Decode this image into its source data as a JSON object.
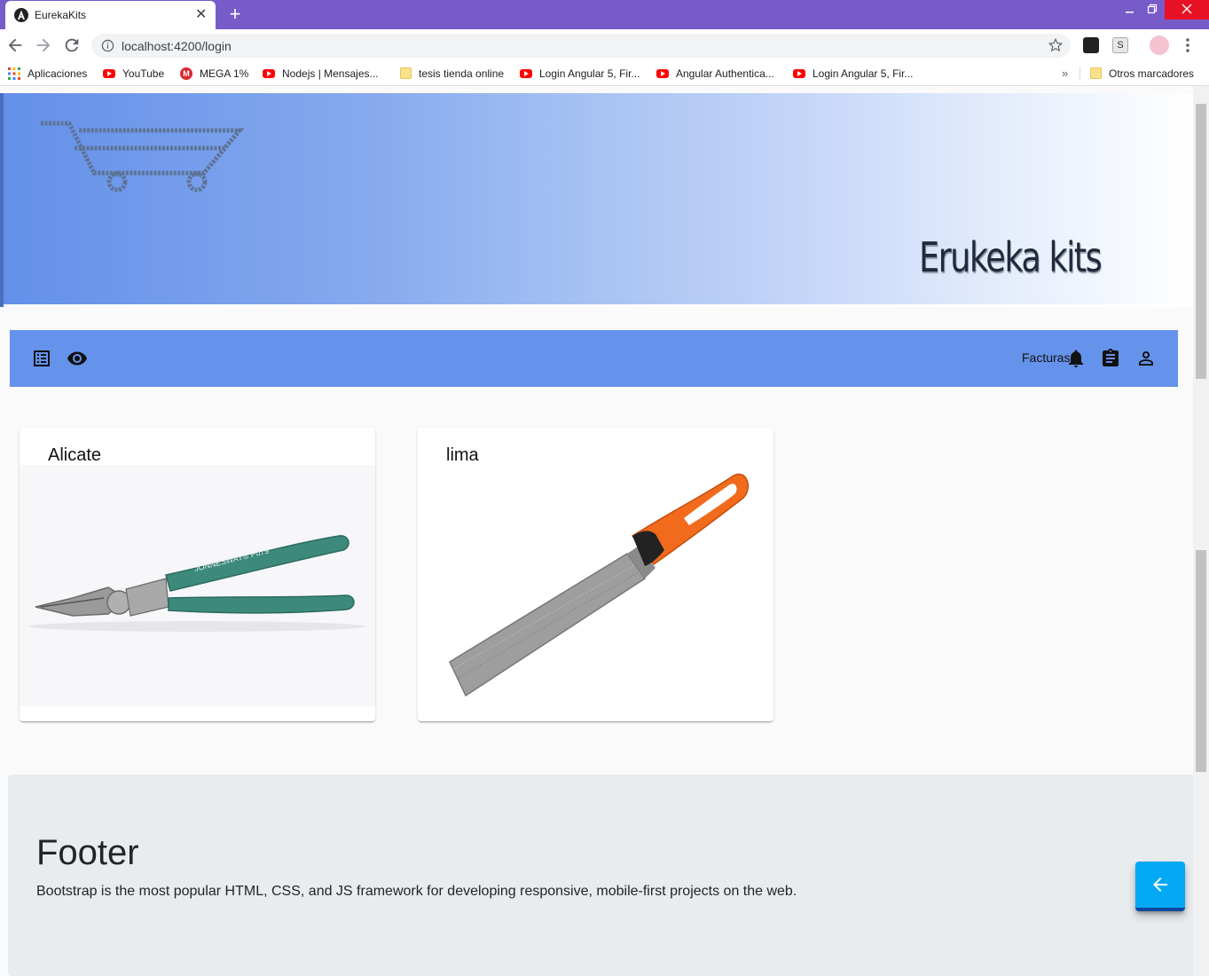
{
  "browser": {
    "tab_title": "EurekaKits",
    "url": "localhost:4200/login",
    "new_tab_symbol": "+",
    "close_symbol": "✕",
    "bookmarks": [
      {
        "label": "Aplicaciones",
        "icon": "apps-icon"
      },
      {
        "label": "YouTube",
        "icon": "youtube-icon"
      },
      {
        "label": "MEGA 1%",
        "icon": "mega-icon"
      },
      {
        "label": "Nodejs | Mensajes...",
        "icon": "youtube-icon"
      },
      {
        "label": "tesis tienda online",
        "icon": "folder-icon"
      },
      {
        "label": "Login Angular 5, Fir...",
        "icon": "youtube-icon"
      },
      {
        "label": "Angular Authentica...",
        "icon": "youtube-icon"
      },
      {
        "label": "Login Angular 5, Fir...",
        "icon": "youtube-icon"
      }
    ],
    "bookmarks_more": "»",
    "other_bookmarks": "Otros marcadores",
    "extension_label": "S"
  },
  "banner": {
    "brand_title": "Erukeka kits"
  },
  "appbar": {
    "facturas_label": "Facturas"
  },
  "products": [
    {
      "name": "Alicate"
    },
    {
      "name": "lima"
    }
  ],
  "footer": {
    "title": "Footer",
    "text": "Bootstrap is the most popular HTML, CSS, and JS framework for developing responsive, mobile-first projects on the web."
  },
  "colors": {
    "tabbar": "#775bc9",
    "appbar": "#6592ea",
    "fab": "#03a9f4"
  }
}
